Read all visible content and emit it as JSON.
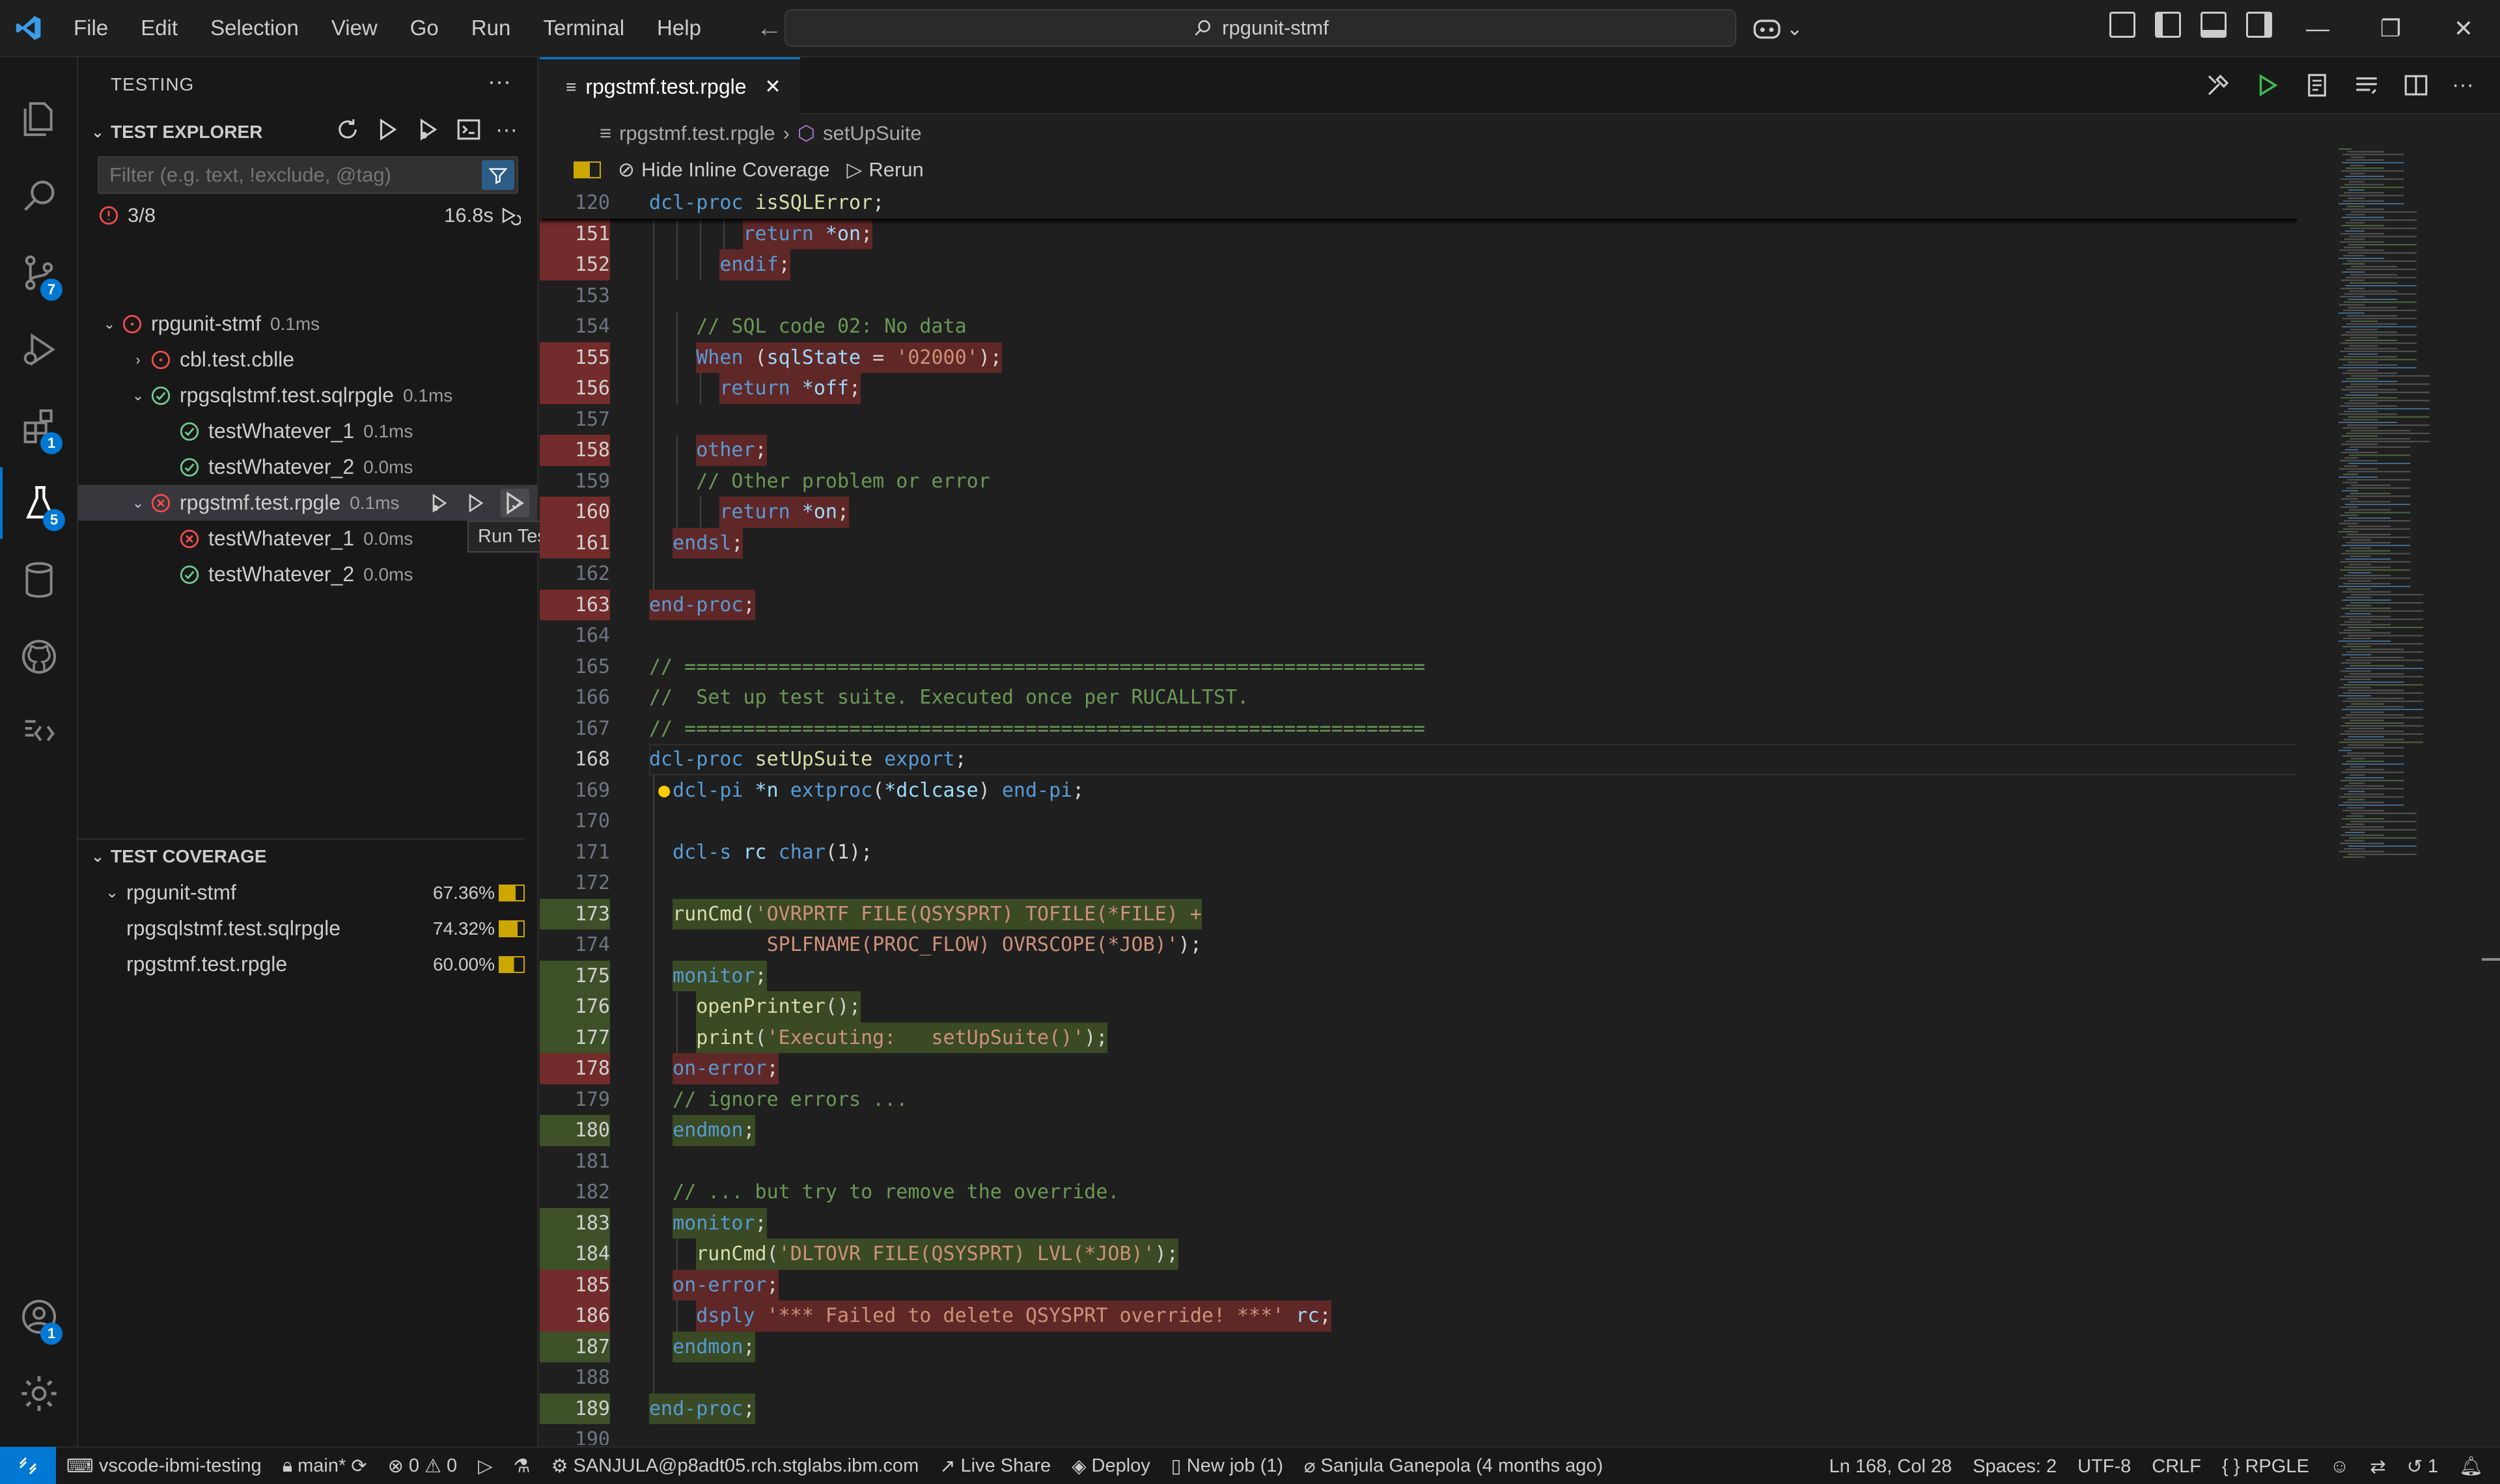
{
  "menu": [
    "File",
    "Edit",
    "Selection",
    "View",
    "Go",
    "Run",
    "Terminal",
    "Help"
  ],
  "command_center": {
    "text": "rpgunit-stmf"
  },
  "activity_badges": {
    "source_control": "7",
    "extensions": "1",
    "testing": "5",
    "accounts": "1"
  },
  "sidebar": {
    "title": "TESTING",
    "test_explorer": {
      "header": "TEST EXPLORER",
      "filter_placeholder": "Filter (e.g. text, !exclude, @tag)",
      "summary": "3/8",
      "duration": "16.8s",
      "tree": [
        {
          "label": "rpgunit-stmf",
          "dur": "0.1ms",
          "status": "fail-outline"
        },
        {
          "label": "cbl.test.cblle",
          "dur": "",
          "status": "fail-outline"
        },
        {
          "label": "rpgsqlstmf.test.sqlrpgle",
          "dur": "0.1ms",
          "status": "pass"
        },
        {
          "label": "testWhatever_1",
          "dur": "0.1ms",
          "status": "pass"
        },
        {
          "label": "testWhatever_2",
          "dur": "0.0ms",
          "status": "pass"
        },
        {
          "label": "rpgstmf.test.rpgle",
          "dur": "0.1ms",
          "status": "fail"
        },
        {
          "label": "testWhatever_1",
          "dur": "0.0ms",
          "status": "fail"
        },
        {
          "label": "testWhatever_2",
          "dur": "0.0ms",
          "status": "pass"
        }
      ],
      "tooltip": "Run Test with Coverage"
    },
    "test_coverage": {
      "header": "TEST COVERAGE",
      "items": [
        {
          "label": "rpgunit-stmf",
          "pct": "67.36%",
          "fill": 67.36
        },
        {
          "label": "rpgsqlstmf.test.sqlrpgle",
          "pct": "74.32%",
          "fill": 74.32
        },
        {
          "label": "rpgstmf.test.rpgle",
          "pct": "60.00%",
          "fill": 60.0
        }
      ]
    }
  },
  "editor": {
    "tab": "rpgstmf.test.rpgle",
    "breadcrumb": [
      "rpgstmf.test.rpgle",
      "setUpSuite"
    ],
    "codelens": {
      "hide": "Hide Inline Coverage",
      "rerun": "Rerun"
    }
  },
  "code_lines": [
    {
      "n": "120",
      "sticky": true,
      "cov": "none",
      "segs": [
        [
          "k",
          "dcl-proc "
        ],
        [
          "f",
          "isSQLError"
        ],
        [
          "p",
          ";"
        ]
      ]
    },
    {
      "n": "151",
      "cov": "red",
      "indent": 3,
      "segs": [
        [
          "k",
          "return "
        ],
        [
          "v",
          "*on"
        ],
        [
          "p",
          ";"
        ]
      ]
    },
    {
      "n": "152",
      "cov": "red",
      "indent": 2,
      "segs": [
        [
          "k",
          "endif"
        ],
        [
          "p",
          ";"
        ]
      ]
    },
    {
      "n": "153",
      "cov": "none",
      "indent": 0,
      "segs": []
    },
    {
      "n": "154",
      "cov": "none",
      "indent": 1,
      "segs": [
        [
          "c",
          "// SQL code 02: No data"
        ]
      ]
    },
    {
      "n": "155",
      "cov": "red",
      "indent": 1,
      "segs": [
        [
          "k",
          "When "
        ],
        [
          "p",
          "("
        ],
        [
          "v",
          "sqlState"
        ],
        [
          "p",
          " = "
        ],
        [
          "s",
          "'02000'"
        ],
        [
          "p",
          ");"
        ]
      ]
    },
    {
      "n": "156",
      "cov": "red",
      "indent": 2,
      "segs": [
        [
          "k",
          "return "
        ],
        [
          "v",
          "*off"
        ],
        [
          "p",
          ";"
        ]
      ]
    },
    {
      "n": "157",
      "cov": "none",
      "indent": 0,
      "segs": []
    },
    {
      "n": "158",
      "cov": "red",
      "indent": 1,
      "segs": [
        [
          "k",
          "other"
        ],
        [
          "p",
          ";"
        ]
      ]
    },
    {
      "n": "159",
      "cov": "none",
      "indent": 1,
      "segs": [
        [
          "c",
          "// Other problem or error"
        ]
      ]
    },
    {
      "n": "160",
      "cov": "red",
      "indent": 2,
      "segs": [
        [
          "k",
          "return "
        ],
        [
          "v",
          "*on"
        ],
        [
          "p",
          ";"
        ]
      ]
    },
    {
      "n": "161",
      "cov": "red",
      "indent": 0,
      "segs": [
        [
          "k",
          "endsl"
        ],
        [
          "p",
          ";"
        ]
      ]
    },
    {
      "n": "162",
      "cov": "none",
      "indent": 0,
      "segs": []
    },
    {
      "n": "163",
      "cov": "red",
      "indent": -1,
      "segs": [
        [
          "k",
          "end-proc"
        ],
        [
          "p",
          ";"
        ]
      ]
    },
    {
      "n": "164",
      "cov": "none",
      "indent": -1,
      "segs": []
    },
    {
      "n": "165",
      "cov": "none",
      "indent": -1,
      "segs": [
        [
          "c",
          "// ==============================================================="
        ]
      ]
    },
    {
      "n": "166",
      "cov": "none",
      "indent": -1,
      "segs": [
        [
          "c",
          "//  Set up test suite. Executed once per RUCALLTST."
        ]
      ]
    },
    {
      "n": "167",
      "cov": "none",
      "indent": -1,
      "segs": [
        [
          "c",
          "// ==============================================================="
        ]
      ]
    },
    {
      "n": "168",
      "cov": "cur",
      "indent": -1,
      "segs": [
        [
          "k",
          "dcl-proc "
        ],
        [
          "f",
          "setUpSuite "
        ],
        [
          "k",
          "export"
        ],
        [
          "p",
          ";"
        ]
      ]
    },
    {
      "n": "169",
      "cov": "none",
      "indent": 0,
      "segs": [
        [
          "k",
          "dcl-pi "
        ],
        [
          "v",
          "*n "
        ],
        [
          "k",
          "extproc"
        ],
        [
          "p",
          "("
        ],
        [
          "v",
          "*dclcase"
        ],
        [
          "p",
          ") "
        ],
        [
          "k",
          "end-pi"
        ],
        [
          "p",
          ";"
        ]
      ]
    },
    {
      "n": "170",
      "cov": "none",
      "indent": 0,
      "segs": []
    },
    {
      "n": "171",
      "cov": "none",
      "indent": 0,
      "segs": [
        [
          "k",
          "dcl-s "
        ],
        [
          "v",
          "rc "
        ],
        [
          "k",
          "char"
        ],
        [
          "p",
          "(1);"
        ]
      ]
    },
    {
      "n": "172",
      "cov": "none",
      "indent": 0,
      "segs": []
    },
    {
      "n": "173",
      "cov": "green",
      "indent": 0,
      "segs": [
        [
          "f",
          "runCmd"
        ],
        [
          "p",
          "("
        ],
        [
          "s",
          "'OVRPRTF FILE(QSYSPRT) TOFILE(*FILE) +"
        ]
      ]
    },
    {
      "n": "174",
      "cov": "none",
      "indent": 0,
      "segs": [
        [
          "s",
          "        SPLFNAME(PROC_FLOW) OVRSCOPE(*JOB)'"
        ],
        [
          "p",
          ");"
        ]
      ]
    },
    {
      "n": "175",
      "cov": "green",
      "indent": 0,
      "segs": [
        [
          "k",
          "monitor"
        ],
        [
          "p",
          ";"
        ]
      ]
    },
    {
      "n": "176",
      "cov": "green",
      "indent": 1,
      "segs": [
        [
          "f",
          "openPrinter"
        ],
        [
          "p",
          "();"
        ]
      ]
    },
    {
      "n": "177",
      "cov": "green",
      "indent": 1,
      "segs": [
        [
          "f",
          "print"
        ],
        [
          "p",
          "("
        ],
        [
          "s",
          "'Executing:   setUpSuite()'"
        ],
        [
          "p",
          ");"
        ]
      ]
    },
    {
      "n": "178",
      "cov": "red",
      "indent": 0,
      "segs": [
        [
          "k",
          "on-error"
        ],
        [
          "p",
          ";"
        ]
      ]
    },
    {
      "n": "179",
      "cov": "none",
      "indent": 0,
      "segs": [
        [
          "c",
          "// ignore errors ..."
        ]
      ]
    },
    {
      "n": "180",
      "cov": "green",
      "indent": 0,
      "segs": [
        [
          "k",
          "endmon"
        ],
        [
          "p",
          ";"
        ]
      ]
    },
    {
      "n": "181",
      "cov": "none",
      "indent": 0,
      "segs": []
    },
    {
      "n": "182",
      "cov": "none",
      "indent": 0,
      "segs": [
        [
          "c",
          "// ... but try to remove the override."
        ]
      ]
    },
    {
      "n": "183",
      "cov": "green",
      "indent": 0,
      "segs": [
        [
          "k",
          "monitor"
        ],
        [
          "p",
          ";"
        ]
      ]
    },
    {
      "n": "184",
      "cov": "green",
      "indent": 1,
      "segs": [
        [
          "f",
          "runCmd"
        ],
        [
          "p",
          "("
        ],
        [
          "s",
          "'DLTOVR FILE(QSYSPRT) LVL(*JOB)'"
        ],
        [
          "p",
          ");"
        ]
      ]
    },
    {
      "n": "185",
      "cov": "red",
      "indent": 0,
      "segs": [
        [
          "k",
          "on-error"
        ],
        [
          "p",
          ";"
        ]
      ]
    },
    {
      "n": "186",
      "cov": "red",
      "indent": 1,
      "segs": [
        [
          "k",
          "dsply "
        ],
        [
          "s",
          "'*** Failed to delete QSYSPRT override! ***' "
        ],
        [
          "v",
          "rc"
        ],
        [
          "p",
          ";"
        ]
      ]
    },
    {
      "n": "187",
      "cov": "green",
      "indent": 0,
      "segs": [
        [
          "k",
          "endmon"
        ],
        [
          "p",
          ";"
        ]
      ]
    },
    {
      "n": "188",
      "cov": "none",
      "indent": 0,
      "segs": []
    },
    {
      "n": "189",
      "cov": "green",
      "indent": -1,
      "segs": [
        [
          "k",
          "end-proc"
        ],
        [
          "p",
          ";"
        ]
      ]
    },
    {
      "n": "190",
      "cov": "none",
      "indent": -1,
      "segs": []
    }
  ],
  "statusbar": {
    "project": "vscode-ibmi-testing",
    "branch": "main*",
    "errors": "0",
    "warnings": "0",
    "connection": "SANJULA@p8adt05.rch.stglabs.ibm.com",
    "live_share": "Live Share",
    "deploy": "Deploy",
    "new_job": "New job (1)",
    "blame": "Sanjula Ganepola (4 months ago)",
    "position": "Ln 168, Col 28",
    "spaces": "Spaces: 2",
    "encoding": "UTF-8",
    "eol": "CRLF",
    "language": "RPGLE",
    "history": "1"
  },
  "colors": {
    "accent": "#0078d4",
    "coverage_red": "#8b2f2f",
    "coverage_green": "#4f6a2a",
    "coverage_bar": "#cca700"
  }
}
